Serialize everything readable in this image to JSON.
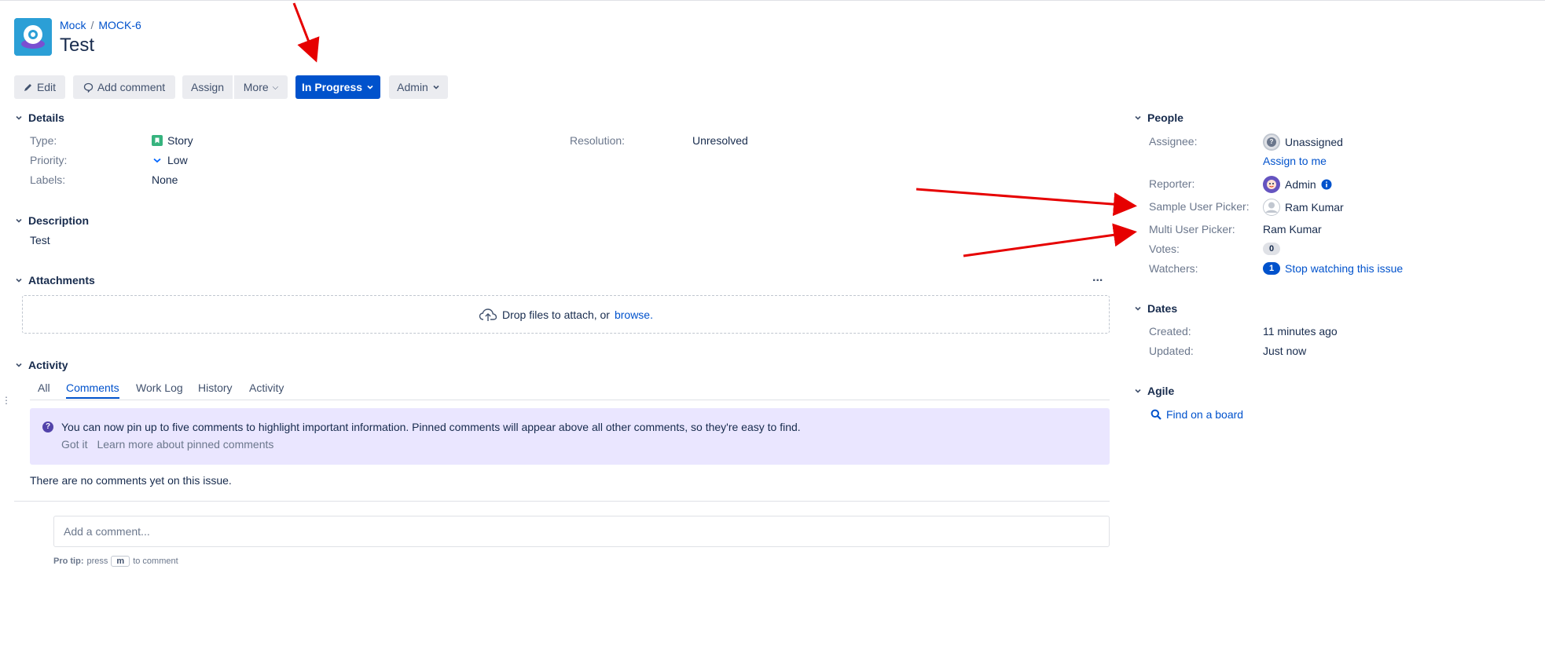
{
  "breadcrumb": {
    "project": "Mock",
    "separator": "/",
    "issue_key": "MOCK-6"
  },
  "issue": {
    "title": "Test"
  },
  "toolbar": {
    "edit": "Edit",
    "add_comment": "Add comment",
    "assign": "Assign",
    "more": "More",
    "status": "In Progress",
    "admin": "Admin"
  },
  "details": {
    "heading": "Details",
    "type_label": "Type:",
    "type_value": "Story",
    "priority_label": "Priority:",
    "priority_value": "Low",
    "labels_label": "Labels:",
    "labels_value": "None",
    "resolution_label": "Resolution:",
    "resolution_value": "Unresolved"
  },
  "description": {
    "heading": "Description",
    "text": "Test"
  },
  "attachments": {
    "heading": "Attachments",
    "more": "...",
    "drop_text": "Drop files to attach, or",
    "browse": "browse."
  },
  "activity": {
    "heading": "Activity",
    "tabs": [
      "All",
      "Comments",
      "Work Log",
      "History",
      "Activity"
    ],
    "active_tab": "Comments",
    "pin_message": "You can now pin up to five comments to highlight important information. Pinned comments will appear above all other comments, so they're easy to find.",
    "pin_got_it": "Got it",
    "pin_learn_more": "Learn more about pinned comments",
    "no_comments": "There are no comments yet on this issue.",
    "comment_placeholder": "Add a comment...",
    "protip_label": "Pro tip:",
    "protip_press": "press",
    "protip_key": "m",
    "protip_suffix": "to comment"
  },
  "people": {
    "heading": "People",
    "assignee_label": "Assignee:",
    "assignee_value": "Unassigned",
    "assign_to_me": "Assign to me",
    "reporter_label": "Reporter:",
    "reporter_value": "Admin",
    "sample_picker_label": "Sample User Picker:",
    "sample_picker_value": "Ram Kumar",
    "multi_picker_label": "Multi User Picker:",
    "multi_picker_value": "Ram Kumar",
    "votes_label": "Votes:",
    "votes_value": "0",
    "watchers_label": "Watchers:",
    "watchers_count": "1",
    "watchers_link": "Stop watching this issue"
  },
  "dates": {
    "heading": "Dates",
    "created_label": "Created:",
    "created_value": "11 minutes ago",
    "updated_label": "Updated:",
    "updated_value": "Just now"
  },
  "agile": {
    "heading": "Agile",
    "find_on_board": "Find on a board"
  },
  "colors": {
    "primary": "#0052cc",
    "text": "#172b4d",
    "muted": "#6b778c",
    "button_bg": "#ebecf0",
    "pin_banner_bg": "#eae6ff",
    "story_green": "#36b37e",
    "annotation_arrow": "#e60000"
  }
}
